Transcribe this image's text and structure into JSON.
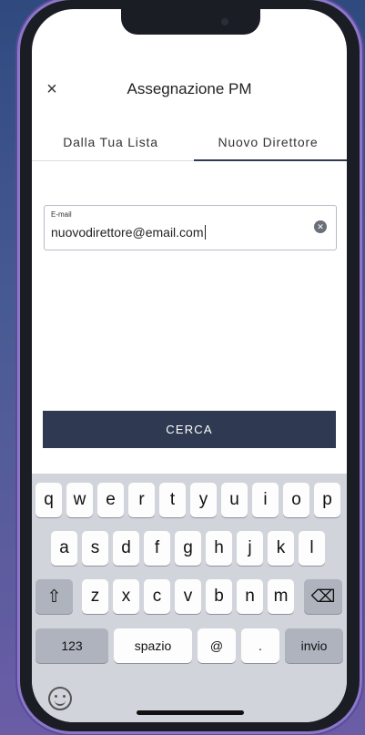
{
  "header": {
    "close_icon": "×",
    "title": "Assegnazione PM"
  },
  "tabs": [
    {
      "label": "Dalla Tua Lista",
      "active": false
    },
    {
      "label": "Nuovo Direttore",
      "active": true
    }
  ],
  "email_field": {
    "label": "E-mail",
    "value": "nuovodirettore@email.com",
    "clear_icon": "clear-icon"
  },
  "search_button": {
    "label": "CERCA"
  },
  "keyboard": {
    "row1": [
      "q",
      "w",
      "e",
      "r",
      "t",
      "y",
      "u",
      "i",
      "o",
      "p"
    ],
    "row2": [
      "a",
      "s",
      "d",
      "f",
      "g",
      "h",
      "j",
      "k",
      "l"
    ],
    "row3": [
      "z",
      "x",
      "c",
      "v",
      "b",
      "n",
      "m"
    ],
    "shift_icon": "⇧",
    "backspace_icon": "⌫",
    "numbers_label": "123",
    "space_label": "spazio",
    "at_label": "@",
    "dot_label": ".",
    "return_label": "invio",
    "emoji_icon": "emoji-icon"
  },
  "colors": {
    "primary": "#2f3a52",
    "keyboard_bg": "#d1d4db"
  }
}
